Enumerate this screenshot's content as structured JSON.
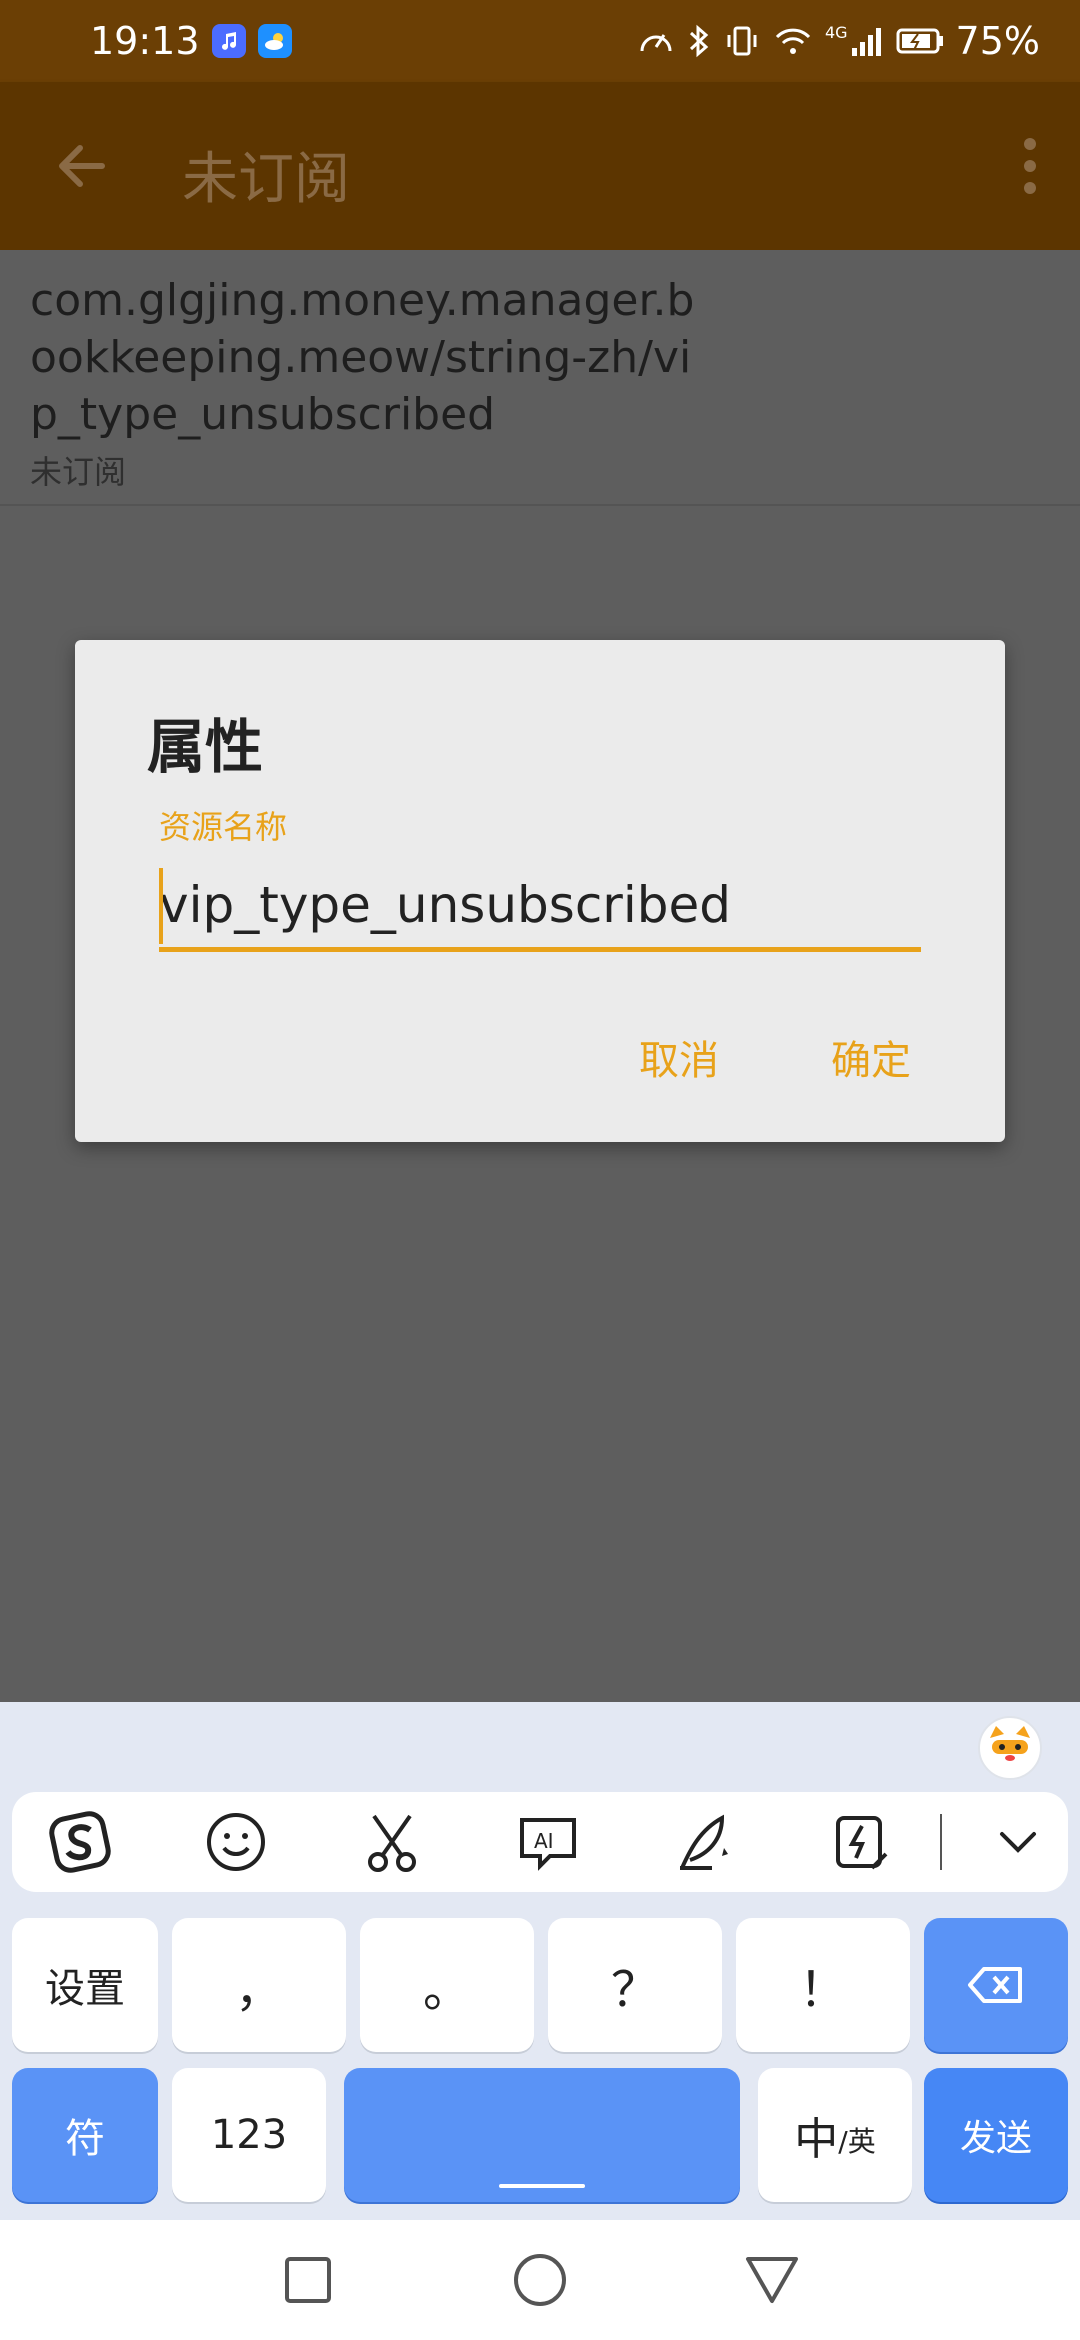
{
  "status_bar": {
    "time": "19:13",
    "battery": "75%",
    "network": "4G"
  },
  "toolbar": {
    "title": "未订阅"
  },
  "list_item": {
    "path": "com.glgjing.money.manager.bookkeeping.meow/string-zh/vip_type_unsubscribed",
    "subtitle": "未订阅"
  },
  "dialog": {
    "title": "属性",
    "field_label": "资源名称",
    "field_value": "vip_type_unsubscribed",
    "cancel_label": "取消",
    "ok_label": "确定"
  },
  "keyboard": {
    "row1": {
      "settings": "设置",
      "comma": "，",
      "period": "。",
      "question": "？",
      "exclaim": "！"
    },
    "row2": {
      "symbols": "符",
      "numbers": "123",
      "lang_main": "中",
      "lang_alt": "/英",
      "send": "发送"
    },
    "tools": [
      "sogou-logo-icon",
      "emoji-icon",
      "scissors-icon",
      "ai-chat-icon",
      "quill-icon",
      "quick-phrase-icon",
      "chevron-down-icon"
    ]
  },
  "colors": {
    "accent": "#e8a21a",
    "toolbar": "#5c3500",
    "status_bar": "#6b3f05",
    "key_blue": "#5a93f6"
  }
}
